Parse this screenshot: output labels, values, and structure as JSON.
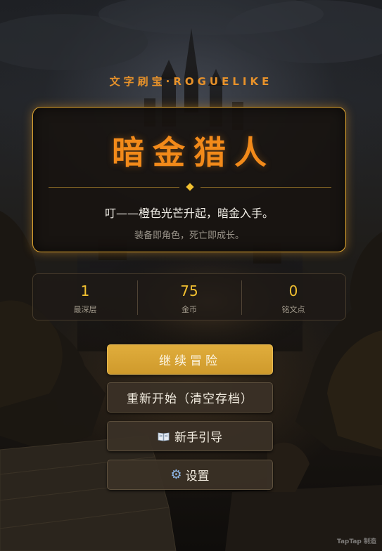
{
  "header": {
    "subtitle": "文字刷宝·ROGUELIKE"
  },
  "title_card": {
    "title": "暗金猎人",
    "tagline": "叮——橙色光芒升起，暗金入手。",
    "slogan": "装备即角色，死亡即成长。"
  },
  "stats": [
    {
      "value": "1",
      "label": "最深层"
    },
    {
      "value": "75",
      "label": "金币"
    },
    {
      "value": "0",
      "label": "铭文点"
    }
  ],
  "menu": {
    "continue_label": "继续冒险",
    "restart_label": "重新开始（清空存档）",
    "guide_label": "新手引导",
    "settings_label": "设置",
    "guide_icon": "book-icon",
    "settings_icon": "gear-icon"
  },
  "watermark": "TapTap 制造",
  "colors": {
    "accent": "#f28a1a",
    "gold": "#f2c030",
    "button_primary": "#d9a535",
    "button_dark": "#3a3026"
  }
}
